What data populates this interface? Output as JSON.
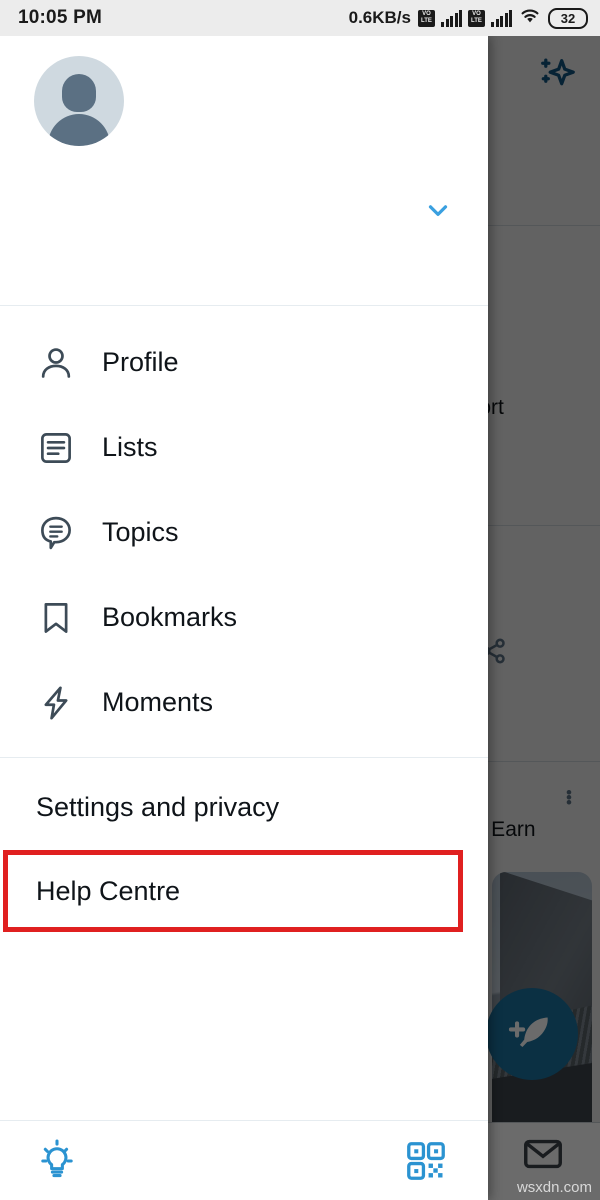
{
  "statusbar": {
    "time": "10:05 PM",
    "network_speed": "0.6KB/s",
    "volte_label_1": "VO LTE",
    "volte_label_2": "VO LTE",
    "battery_level": "32",
    "icons": [
      "volte-icon",
      "signal-bars-icon",
      "wifi-icon",
      "battery-icon"
    ]
  },
  "drawer": {
    "avatar_alt": "default-profile-avatar",
    "account_toggle_icon": "chevron-down-icon",
    "accent_color": "#1d9bf0",
    "nav_items": [
      {
        "label": "Profile",
        "icon": "person-icon"
      },
      {
        "label": "Lists",
        "icon": "list-icon"
      },
      {
        "label": "Topics",
        "icon": "topics-bubble-icon"
      },
      {
        "label": "Bookmarks",
        "icon": "bookmark-icon"
      },
      {
        "label": "Moments",
        "icon": "lightning-bolt-icon"
      }
    ],
    "secondary_items": [
      {
        "label": "Settings and privacy",
        "highlighted": false
      },
      {
        "label": "Help Centre",
        "highlighted": true
      }
    ],
    "highlight_color": "#e02020",
    "bottom_bar": {
      "night_mode_icon": "lightbulb-icon",
      "qr_icon": "qr-code-icon"
    }
  },
  "background": {
    "sparkle_icon": "sparkle-icon",
    "share_icon": "share-icon",
    "overflow_icon": "three-dots-icon",
    "compose_icon": "compose-tweet-feather-icon",
    "messages_icon": "envelope-icon",
    "snippets": [
      {
        "text": "pport"
      },
      {
        "text": "er. Earn"
      }
    ],
    "photo_alt": "building-roof-photo"
  },
  "watermark": {
    "text": "wsxdn.com"
  }
}
